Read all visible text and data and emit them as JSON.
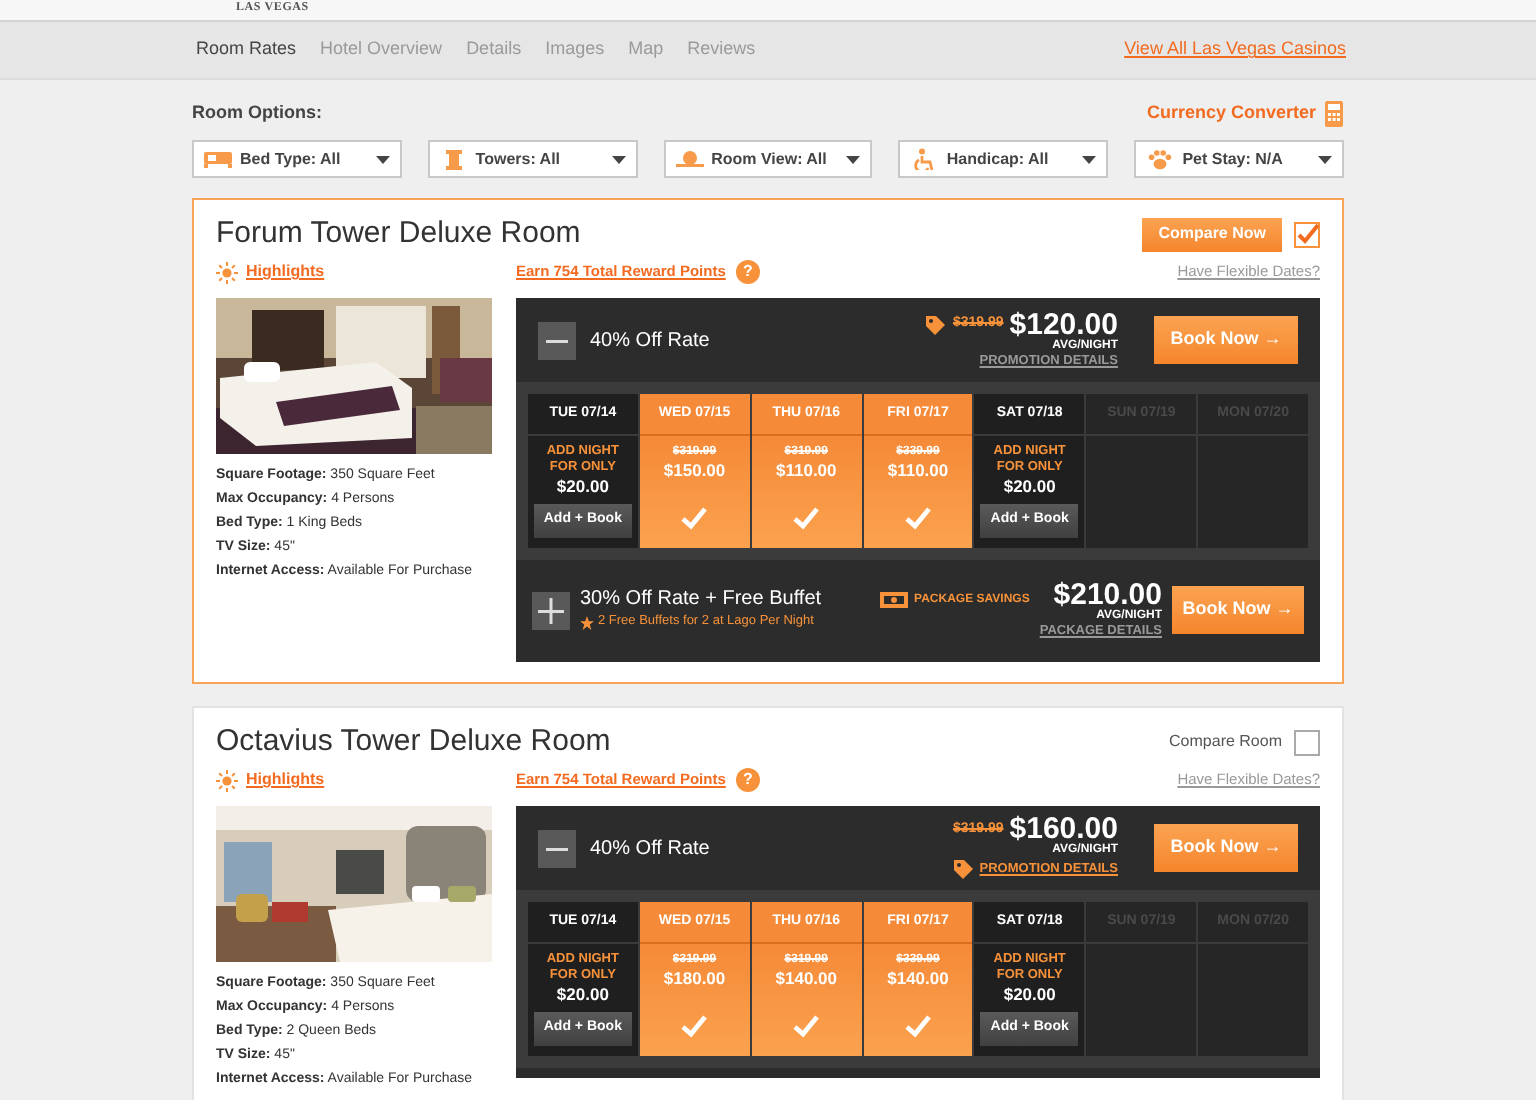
{
  "logo": {
    "text": "LAS VEGAS"
  },
  "nav": {
    "tabs": [
      {
        "label": "Room Rates",
        "selected": true
      },
      {
        "label": "Hotel Overview",
        "selected": false
      },
      {
        "label": "Details",
        "selected": false
      },
      {
        "label": "Images",
        "selected": false
      },
      {
        "label": "Map",
        "selected": false
      },
      {
        "label": "Reviews",
        "selected": false
      }
    ],
    "link": "View All Las Vegas Casinos"
  },
  "options": {
    "title": "Room Options:",
    "currency_converter": "Currency Converter",
    "filters": [
      {
        "label": "Bed Type: All"
      },
      {
        "label": "Towers: All"
      },
      {
        "label": "Room View: All"
      },
      {
        "label": "Handicap: All"
      },
      {
        "label": "Pet Stay: N/A"
      }
    ]
  },
  "rooms": [
    {
      "name": "Forum Tower Deluxe Room",
      "compare": {
        "label": "Compare Now",
        "checked": true
      },
      "highlights": "Highlights",
      "rewards": "Earn 754 Total Reward Points",
      "help": "?",
      "flexible": "Have Flexible Dates?",
      "specs": [
        {
          "label": "Square Footage:",
          "value": "350 Square Feet"
        },
        {
          "label": "Max Occupancy:",
          "value": "4 Persons"
        },
        {
          "label": "Bed Type:",
          "value": "1 King Beds"
        },
        {
          "label": "TV Size:",
          "value": "45\""
        },
        {
          "label": "Internet Access:",
          "value": "Available For Purchase"
        }
      ],
      "rate": {
        "expanded": true,
        "title": "40% Off Rate",
        "old_price": "$319.99",
        "price": "$120.00",
        "per": "AVG/NIGHT",
        "details": "PROMOTION DETAILS",
        "details_highlighted": false,
        "book": "Book Now →"
      },
      "days": [
        {
          "kind": "addon",
          "date": "TUE 07/14",
          "note": "ADD NIGHT FOR ONLY",
          "price": "$20.00",
          "button": "Add + Book"
        },
        {
          "kind": "booked",
          "date": "WED 07/15",
          "old_price": "$319.99",
          "price": "$150.00"
        },
        {
          "kind": "booked",
          "date": "THU 07/16",
          "old_price": "$319.99",
          "price": "$110.00"
        },
        {
          "kind": "booked",
          "date": "FRI 07/17",
          "old_price": "$339.99",
          "price": "$110.00"
        },
        {
          "kind": "addon",
          "date": "SAT 07/18",
          "note": "ADD NIGHT FOR ONLY",
          "price": "$20.00",
          "button": "Add + Book"
        },
        {
          "kind": "unavailable",
          "date": "SUN 07/19"
        },
        {
          "kind": "unavailable",
          "date": "MON 07/20"
        }
      ],
      "package": {
        "expanded": false,
        "title": "30% Off Rate + Free Buffet",
        "subtitle": "2 Free Buffets for 2 at Lago Per Night",
        "savings": "PACKAGE SAVINGS",
        "price": "$210.00",
        "per": "AVG/NIGHT",
        "details": "PACKAGE DETAILS",
        "book": "Book Now →"
      }
    },
    {
      "name": "Octavius Tower Deluxe Room",
      "compare": {
        "label": "Compare Room",
        "checked": false
      },
      "highlights": "Highlights",
      "rewards": "Earn 754 Total Reward Points",
      "help": "?",
      "flexible": "Have Flexible Dates?",
      "specs": [
        {
          "label": "Square Footage:",
          "value": "350 Square Feet"
        },
        {
          "label": "Max Occupancy:",
          "value": "4 Persons"
        },
        {
          "label": "Bed Type:",
          "value": "2 Queen Beds"
        },
        {
          "label": "TV Size:",
          "value": "45\""
        },
        {
          "label": "Internet Access:",
          "value": "Available For Purchase"
        }
      ],
      "rate": {
        "expanded": true,
        "title": "40% Off Rate",
        "old_price": "$319.99",
        "price": "$160.00",
        "per": "AVG/NIGHT",
        "details": "PROMOTION DETAILS",
        "details_highlighted": true,
        "book": "Book Now →"
      },
      "days": [
        {
          "kind": "addon",
          "date": "TUE 07/14",
          "note": "ADD NIGHT FOR ONLY",
          "price": "$20.00",
          "button": "Add + Book"
        },
        {
          "kind": "booked",
          "date": "WED 07/15",
          "old_price": "$319.99",
          "price": "$180.00"
        },
        {
          "kind": "booked",
          "date": "THU 07/16",
          "old_price": "$319.99",
          "price": "$140.00"
        },
        {
          "kind": "booked",
          "date": "FRI 07/17",
          "old_price": "$339.99",
          "price": "$140.00"
        },
        {
          "kind": "addon",
          "date": "SAT 07/18",
          "note": "ADD NIGHT FOR ONLY",
          "price": "$20.00",
          "button": "Add + Book"
        },
        {
          "kind": "unavailable",
          "date": "SUN 07/19"
        },
        {
          "kind": "unavailable",
          "date": "MON 07/20"
        }
      ]
    }
  ]
}
